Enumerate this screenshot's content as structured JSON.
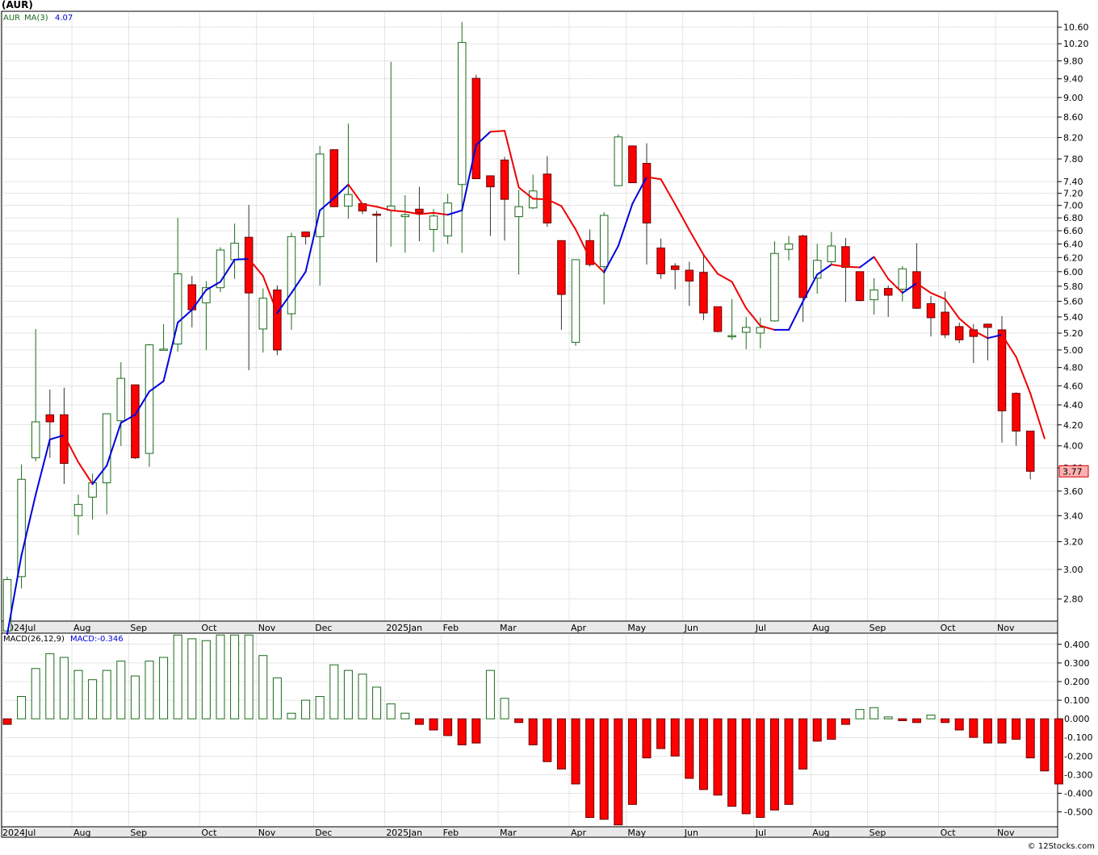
{
  "header": {
    "title": "(AUR)"
  },
  "footer": {
    "credit": "© 12Stocks.com"
  },
  "colors": {
    "up": "#1a6b1a",
    "down": "#ff0000",
    "ma_up": "#0000dd",
    "ma_down": "#ee0000",
    "grid": "#999999",
    "price_tag_bg": "#ffb0b0"
  },
  "chart_data": [
    {
      "type": "candlestick",
      "legend": {
        "symbol": "AUR",
        "ma_label": "MA(3)",
        "ma_value": "4.07"
      },
      "scale": "log",
      "grid": true,
      "ylim": [
        2.66,
        11.0
      ],
      "y_ticks": [
        "2.80",
        "3.00",
        "3.20",
        "3.40",
        "3.60",
        "3.80",
        "4.00",
        "4.20",
        "4.40",
        "4.60",
        "4.80",
        "5.00",
        "5.20",
        "5.40",
        "5.60",
        "5.80",
        "6.00",
        "6.20",
        "6.40",
        "6.60",
        "6.80",
        "7.00",
        "7.20",
        "7.40",
        "7.80",
        "8.20",
        "8.60",
        "9.00",
        "9.40",
        "9.80",
        "10.20",
        "10.60"
      ],
      "x_labels": [
        {
          "label": "2024Jul",
          "index": 0
        },
        {
          "label": "Aug",
          "index": 5
        },
        {
          "label": "Sep",
          "index": 9
        },
        {
          "label": "Oct",
          "index": 14
        },
        {
          "label": "Nov",
          "index": 18
        },
        {
          "label": "Dec",
          "index": 22
        },
        {
          "label": "2025Jan",
          "index": 27
        },
        {
          "label": "Feb",
          "index": 31
        },
        {
          "label": "Mar",
          "index": 35
        },
        {
          "label": "Apr",
          "index": 40
        },
        {
          "label": "May",
          "index": 44
        },
        {
          "label": "Jun",
          "index": 48
        },
        {
          "label": "Jul",
          "index": 53
        },
        {
          "label": "Aug",
          "index": 57
        },
        {
          "label": "Sep",
          "index": 61
        },
        {
          "label": "Oct",
          "index": 66
        },
        {
          "label": "Nov",
          "index": 70
        }
      ],
      "last_price": "3.77",
      "candles": [
        {
          "o": 2.6,
          "h": 2.95,
          "l": 2.58,
          "c": 2.93
        },
        {
          "o": 2.95,
          "h": 3.83,
          "l": 2.87,
          "c": 3.7
        },
        {
          "o": 3.89,
          "h": 5.25,
          "l": 3.86,
          "c": 4.23
        },
        {
          "o": 4.3,
          "h": 4.56,
          "l": 3.89,
          "c": 4.23
        },
        {
          "o": 4.3,
          "h": 4.58,
          "l": 3.66,
          "c": 3.84
        },
        {
          "o": 3.4,
          "h": 3.57,
          "l": 3.25,
          "c": 3.49
        },
        {
          "o": 3.55,
          "h": 3.75,
          "l": 3.37,
          "c": 3.67
        },
        {
          "o": 3.67,
          "h": 4.31,
          "l": 3.41,
          "c": 4.31
        },
        {
          "o": 4.24,
          "h": 4.86,
          "l": 4.0,
          "c": 4.68
        },
        {
          "o": 4.61,
          "h": 4.61,
          "l": 3.88,
          "c": 3.89
        },
        {
          "o": 3.93,
          "h": 5.07,
          "l": 3.81,
          "c": 5.06
        },
        {
          "o": 5.01,
          "h": 5.31,
          "l": 5.0,
          "c": 5.01
        },
        {
          "o": 5.07,
          "h": 6.8,
          "l": 4.98,
          "c": 5.97
        },
        {
          "o": 5.82,
          "h": 5.94,
          "l": 5.27,
          "c": 5.49
        },
        {
          "o": 5.58,
          "h": 5.87,
          "l": 5.0,
          "c": 5.78
        },
        {
          "o": 5.78,
          "h": 6.35,
          "l": 5.72,
          "c": 6.31
        },
        {
          "o": 6.17,
          "h": 6.71,
          "l": 5.9,
          "c": 6.41
        },
        {
          "o": 6.5,
          "h": 7.01,
          "l": 4.77,
          "c": 5.71
        },
        {
          "o": 5.25,
          "h": 5.77,
          "l": 4.97,
          "c": 5.64
        },
        {
          "o": 5.75,
          "h": 5.81,
          "l": 4.94,
          "c": 5.0
        },
        {
          "o": 5.44,
          "h": 6.57,
          "l": 5.24,
          "c": 6.51
        },
        {
          "o": 6.58,
          "h": 6.59,
          "l": 6.39,
          "c": 6.51
        },
        {
          "o": 6.51,
          "h": 8.04,
          "l": 5.81,
          "c": 7.89
        },
        {
          "o": 7.97,
          "h": 7.98,
          "l": 6.97,
          "c": 6.98
        },
        {
          "o": 6.99,
          "h": 8.47,
          "l": 6.79,
          "c": 7.18
        },
        {
          "o": 7.03,
          "h": 7.03,
          "l": 6.86,
          "c": 6.91
        },
        {
          "o": 6.86,
          "h": 6.91,
          "l": 6.13,
          "c": 6.85
        },
        {
          "o": 6.92,
          "h": 9.78,
          "l": 6.36,
          "c": 6.99
        },
        {
          "o": 6.82,
          "h": 7.17,
          "l": 6.27,
          "c": 6.85
        },
        {
          "o": 6.94,
          "h": 7.31,
          "l": 6.44,
          "c": 6.88
        },
        {
          "o": 6.62,
          "h": 6.94,
          "l": 6.28,
          "c": 6.83
        },
        {
          "o": 6.52,
          "h": 7.19,
          "l": 6.4,
          "c": 7.04
        },
        {
          "o": 7.35,
          "h": 10.73,
          "l": 6.27,
          "c": 10.23
        },
        {
          "o": 9.41,
          "h": 9.49,
          "l": 7.45,
          "c": 7.45
        },
        {
          "o": 7.5,
          "h": 7.5,
          "l": 6.52,
          "c": 7.31
        },
        {
          "o": 7.78,
          "h": 7.84,
          "l": 6.45,
          "c": 7.1
        },
        {
          "o": 6.82,
          "h": 7.26,
          "l": 5.96,
          "c": 6.98
        },
        {
          "o": 6.96,
          "h": 7.52,
          "l": 6.94,
          "c": 7.24
        },
        {
          "o": 7.53,
          "h": 7.85,
          "l": 6.66,
          "c": 6.72
        },
        {
          "o": 6.45,
          "h": 6.45,
          "l": 5.24,
          "c": 5.69
        },
        {
          "o": 5.09,
          "h": 6.17,
          "l": 5.05,
          "c": 6.17
        },
        {
          "o": 6.45,
          "h": 6.62,
          "l": 6.07,
          "c": 6.1
        },
        {
          "o": 6.07,
          "h": 6.89,
          "l": 5.56,
          "c": 6.84
        },
        {
          "o": 7.33,
          "h": 8.26,
          "l": 7.32,
          "c": 8.21
        },
        {
          "o": 8.04,
          "h": 8.04,
          "l": 7.38,
          "c": 7.38
        },
        {
          "o": 7.72,
          "h": 8.09,
          "l": 6.1,
          "c": 6.72
        },
        {
          "o": 6.34,
          "h": 6.48,
          "l": 5.9,
          "c": 5.97
        },
        {
          "o": 6.08,
          "h": 6.12,
          "l": 5.76,
          "c": 6.03
        },
        {
          "o": 6.02,
          "h": 6.14,
          "l": 5.54,
          "c": 5.87
        },
        {
          "o": 5.99,
          "h": 6.23,
          "l": 5.36,
          "c": 5.45
        },
        {
          "o": 5.53,
          "h": 5.53,
          "l": 5.21,
          "c": 5.22
        },
        {
          "o": 5.17,
          "h": 5.63,
          "l": 5.12,
          "c": 5.17
        },
        {
          "o": 5.21,
          "h": 5.4,
          "l": 5.01,
          "c": 5.27
        },
        {
          "o": 5.2,
          "h": 5.39,
          "l": 5.02,
          "c": 5.27
        },
        {
          "o": 5.35,
          "h": 6.44,
          "l": 5.34,
          "c": 6.26
        },
        {
          "o": 6.32,
          "h": 6.52,
          "l": 6.16,
          "c": 6.4
        },
        {
          "o": 6.52,
          "h": 6.54,
          "l": 5.34,
          "c": 5.65
        },
        {
          "o": 5.91,
          "h": 6.4,
          "l": 5.7,
          "c": 6.16
        },
        {
          "o": 6.14,
          "h": 6.58,
          "l": 6.1,
          "c": 6.37
        },
        {
          "o": 6.36,
          "h": 6.49,
          "l": 5.59,
          "c": 6.06
        },
        {
          "o": 6.0,
          "h": 6.0,
          "l": 5.6,
          "c": 5.61
        },
        {
          "o": 5.62,
          "h": 5.91,
          "l": 5.43,
          "c": 5.75
        },
        {
          "o": 5.77,
          "h": 5.81,
          "l": 5.4,
          "c": 5.68
        },
        {
          "o": 5.76,
          "h": 6.08,
          "l": 5.6,
          "c": 6.04
        },
        {
          "o": 6.0,
          "h": 6.41,
          "l": 5.5,
          "c": 5.51
        },
        {
          "o": 5.57,
          "h": 5.67,
          "l": 5.16,
          "c": 5.39
        },
        {
          "o": 5.46,
          "h": 5.73,
          "l": 5.14,
          "c": 5.18
        },
        {
          "o": 5.28,
          "h": 5.33,
          "l": 5.08,
          "c": 5.12
        },
        {
          "o": 5.24,
          "h": 5.31,
          "l": 4.85,
          "c": 5.16
        },
        {
          "o": 5.31,
          "h": 5.31,
          "l": 4.88,
          "c": 5.27
        },
        {
          "o": 5.24,
          "h": 5.41,
          "l": 4.03,
          "c": 4.34
        },
        {
          "o": 4.52,
          "h": 4.53,
          "l": 4.0,
          "c": 4.14
        },
        {
          "o": 4.14,
          "h": 4.14,
          "l": 3.7,
          "c": 3.77
        }
      ],
      "ma": [
        2.58,
        3.1,
        3.57,
        4.06,
        4.1,
        3.85,
        3.66,
        3.82,
        4.22,
        4.3,
        4.54,
        4.65,
        5.33,
        5.49,
        5.75,
        5.86,
        6.17,
        6.18,
        5.94,
        5.45,
        5.71,
        6.0,
        6.92,
        7.12,
        7.35,
        7.02,
        6.98,
        6.92,
        6.9,
        6.86,
        6.88,
        6.85,
        6.92,
        8.06,
        8.31,
        8.33,
        7.3,
        7.11,
        7.1,
        6.99,
        6.62,
        6.19,
        5.99,
        6.37,
        7.03,
        7.48,
        7.44,
        7.02,
        6.61,
        6.24,
        5.97,
        5.86,
        5.51,
        5.29,
        5.24,
        5.24,
        5.6,
        5.96,
        6.1,
        6.07,
        6.06,
        6.21,
        5.9,
        5.71,
        5.84,
        5.71,
        5.63,
        5.38,
        5.23,
        5.14,
        5.18,
        4.92,
        4.52,
        4.07
      ],
      "ma_rising": [
        true,
        true,
        true,
        true,
        true,
        false,
        false,
        true,
        true,
        true,
        true,
        true,
        true,
        true,
        true,
        true,
        true,
        true,
        false,
        false,
        true,
        true,
        true,
        true,
        true,
        false,
        false,
        false,
        false,
        false,
        false,
        false,
        true,
        true,
        true,
        false,
        false,
        false,
        false,
        false,
        false,
        false,
        false,
        true,
        true,
        true,
        false,
        false,
        false,
        false,
        false,
        false,
        false,
        false,
        false,
        true,
        true,
        true,
        true,
        false,
        false,
        true,
        false,
        false,
        true,
        false,
        false,
        false,
        false,
        false,
        true,
        false,
        false,
        false
      ]
    },
    {
      "type": "bar",
      "legend": {
        "label": "MACD(26,12,9)",
        "value_label": "MACD:-0.346"
      },
      "ylim": [
        -0.58,
        0.46
      ],
      "y_ticks": [
        "0.400",
        "0.300",
        "0.200",
        "0.100",
        "0.000",
        "-0.100",
        "-0.200",
        "-0.300",
        "-0.400",
        "-0.500"
      ],
      "values": [
        -0.03,
        0.12,
        0.27,
        0.35,
        0.33,
        0.26,
        0.21,
        0.26,
        0.31,
        0.23,
        0.31,
        0.33,
        0.45,
        0.43,
        0.42,
        0.45,
        0.45,
        0.45,
        0.34,
        0.22,
        0.03,
        0.1,
        0.12,
        0.29,
        0.26,
        0.24,
        0.17,
        0.08,
        0.03,
        -0.03,
        -0.06,
        -0.09,
        -0.14,
        -0.13,
        0.26,
        0.11,
        -0.02,
        -0.14,
        -0.23,
        -0.27,
        -0.35,
        -0.53,
        -0.54,
        -0.57,
        -0.46,
        -0.21,
        -0.16,
        -0.2,
        -0.32,
        -0.38,
        -0.41,
        -0.47,
        -0.51,
        -0.53,
        -0.49,
        -0.46,
        -0.27,
        -0.12,
        -0.11,
        -0.03,
        0.05,
        0.06,
        0.01,
        -0.01,
        -0.02,
        0.02,
        -0.02,
        -0.06,
        -0.1,
        -0.13,
        -0.13,
        -0.11,
        -0.21,
        -0.28,
        -0.35
      ]
    }
  ]
}
